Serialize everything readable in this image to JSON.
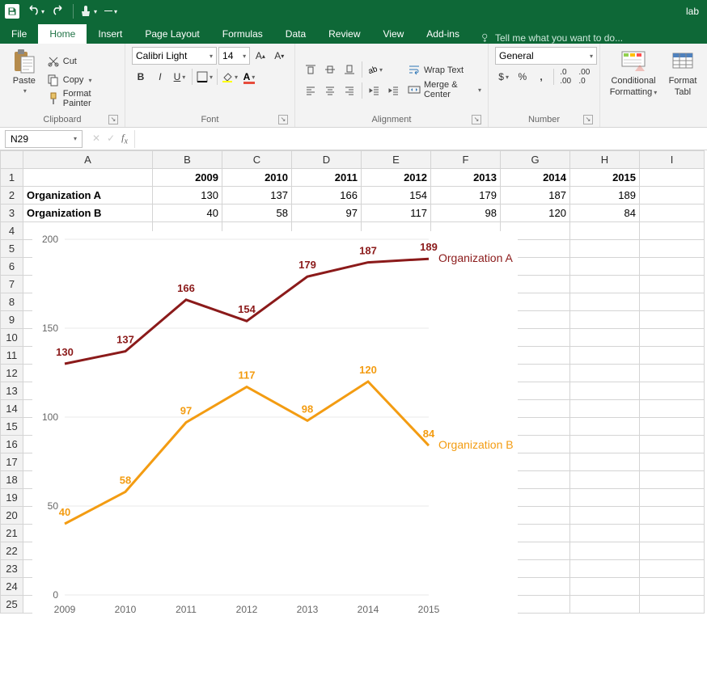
{
  "qat": {
    "undo": "↶",
    "redo": "↷"
  },
  "title_right": "lab",
  "tabs": [
    "File",
    "Home",
    "Insert",
    "Page Layout",
    "Formulas",
    "Data",
    "Review",
    "View",
    "Add-ins"
  ],
  "tellme": "Tell me what you want to do...",
  "clipboard": {
    "paste": "Paste",
    "cut": "Cut",
    "copy": "Copy",
    "formatpainter": "Format Painter",
    "group": "Clipboard"
  },
  "font": {
    "name": "Calibri Light",
    "size": "14",
    "group": "Font"
  },
  "alignment": {
    "wrap": "Wrap Text",
    "merge": "Merge & Center",
    "group": "Alignment"
  },
  "number": {
    "format": "General",
    "group": "Number"
  },
  "styles": {
    "cond": "Conditional Formatting",
    "cond1": "Conditional",
    "cond2": "Formatting",
    "table": "Format as Table",
    "table1": "Format",
    "table2": "Tabl"
  },
  "namebox": "N29",
  "sheet": {
    "headers": [
      "A",
      "B",
      "C",
      "D",
      "E",
      "F",
      "G",
      "H",
      "I"
    ],
    "row1": [
      "",
      "2009",
      "2010",
      "2011",
      "2012",
      "2013",
      "2014",
      "2015",
      ""
    ],
    "row2": [
      "Organization A",
      "130",
      "137",
      "166",
      "154",
      "179",
      "187",
      "189",
      ""
    ],
    "row3": [
      "Organization B",
      "40",
      "58",
      "97",
      "117",
      "98",
      "120",
      "84",
      ""
    ]
  },
  "chart_data": {
    "type": "line",
    "categories": [
      "2009",
      "2010",
      "2011",
      "2012",
      "2013",
      "2014",
      "2015"
    ],
    "series": [
      {
        "name": "Organization A",
        "values": [
          130,
          137,
          166,
          154,
          179,
          187,
          189
        ],
        "color": "#8b1a1a"
      },
      {
        "name": "Organization B",
        "values": [
          40,
          58,
          97,
          117,
          98,
          120,
          84
        ],
        "color": "#f39c12"
      }
    ],
    "ylim": [
      0,
      200
    ],
    "yticks": [
      0,
      50,
      100,
      150,
      200
    ],
    "xlabel": "",
    "ylabel": ""
  }
}
